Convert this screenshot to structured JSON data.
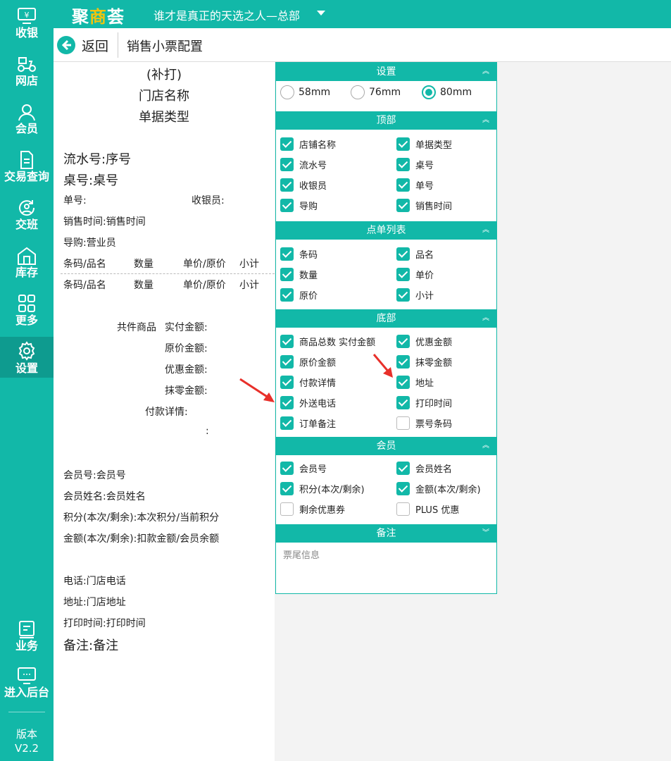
{
  "sidebar": {
    "items": [
      {
        "label": "收银",
        "icon": "cash-register-icon"
      },
      {
        "label": "网店",
        "icon": "scooter-icon"
      },
      {
        "label": "会员",
        "icon": "user-icon"
      },
      {
        "label": "交易查询",
        "icon": "document-icon"
      },
      {
        "label": "交班",
        "icon": "shift-icon"
      },
      {
        "label": "库存",
        "icon": "warehouse-icon"
      },
      {
        "label": "更多",
        "icon": "grid-icon"
      },
      {
        "label": "设置",
        "icon": "gear-icon",
        "active": true
      },
      {
        "label": "业务",
        "icon": "book-icon"
      },
      {
        "label": "进入后台",
        "icon": "monitor-icon"
      }
    ],
    "version_label": "版本",
    "version_number": "V2.2"
  },
  "header": {
    "brand_part1": "聚",
    "brand_part2": "商",
    "brand_part3": "荟",
    "store_title": "谁才是真正的天选之人—总部"
  },
  "subheader": {
    "back_label": "返回",
    "page_title": "销售小票配置"
  },
  "receipt": {
    "reprint": "(补打)",
    "store_name": "门店名称",
    "doc_type": "单据类型",
    "serial": "流水号:序号",
    "table_no": "桌号:桌号",
    "order_no": "单号:",
    "cashier": "收银员:",
    "sale_time": "销售时间:销售时间",
    "guide": "导购:营业员",
    "col_barcode": "条码/品名",
    "col_qty": "数量",
    "col_price": "单价/原价",
    "col_subtotal": "小计",
    "total_goods": "共件商品",
    "paid_amount": "实付金额:",
    "original_amount": "原价金额:",
    "discount_amount": "优惠金额:",
    "rounding_amount": "抹零金额:",
    "payment_detail": "付款详情:",
    "colon": ":",
    "member_no": "会员号:会员号",
    "member_name": "会员姓名:会员姓名",
    "points": "积分(本次/剩余):本次积分/当前积分",
    "amount": "金额(本次/剩余):扣款金额/会员余额",
    "phone": "电话:门店电话",
    "address": "地址:门店地址",
    "print_time": "打印时间:打印时间",
    "remark": "备注:备注"
  },
  "settings": {
    "sections": {
      "settings": "设置",
      "top": "顶部",
      "order_list": "点单列表",
      "bottom": "底部",
      "member": "会员",
      "remark": "备注"
    },
    "paper_sizes": [
      {
        "label": "58mm",
        "selected": false
      },
      {
        "label": "76mm",
        "selected": false
      },
      {
        "label": "80mm",
        "selected": true
      }
    ],
    "top_options": [
      {
        "label": "店铺名称",
        "checked": true
      },
      {
        "label": "单据类型",
        "checked": true
      },
      {
        "label": "流水号",
        "checked": true
      },
      {
        "label": "桌号",
        "checked": true
      },
      {
        "label": "收银员",
        "checked": true
      },
      {
        "label": "单号",
        "checked": true
      },
      {
        "label": "导购",
        "checked": true
      },
      {
        "label": "销售时间",
        "checked": true
      }
    ],
    "list_options": [
      {
        "label": "条码",
        "checked": true
      },
      {
        "label": "品名",
        "checked": true
      },
      {
        "label": "数量",
        "checked": true
      },
      {
        "label": "单价",
        "checked": true
      },
      {
        "label": "原价",
        "checked": true
      },
      {
        "label": "小计",
        "checked": true
      }
    ],
    "bottom_options": [
      {
        "label": "商品总数 实付金额",
        "checked": true
      },
      {
        "label": "优惠金额",
        "checked": true
      },
      {
        "label": "原价金额",
        "checked": true
      },
      {
        "label": "抹零金额",
        "checked": true
      },
      {
        "label": "付款详情",
        "checked": true
      },
      {
        "label": "地址",
        "checked": true
      },
      {
        "label": "外送电话",
        "checked": true
      },
      {
        "label": "打印时间",
        "checked": true
      },
      {
        "label": "订单备注",
        "checked": true
      },
      {
        "label": "票号条码",
        "checked": false
      }
    ],
    "member_options": [
      {
        "label": "会员号",
        "checked": true
      },
      {
        "label": "会员姓名",
        "checked": true
      },
      {
        "label": "积分(本次/剩余)",
        "checked": true
      },
      {
        "label": "金额(本次/剩余)",
        "checked": true
      },
      {
        "label": "剩余优惠券",
        "checked": false
      },
      {
        "label": "PLUS 优惠",
        "checked": false
      }
    ],
    "remark_placeholder": "票尾信息"
  },
  "colors": {
    "accent": "#12b8a8",
    "active_nav": "#0e9b8f",
    "brand_highlight": "#f1c40f",
    "arrow": "#e8302a"
  }
}
